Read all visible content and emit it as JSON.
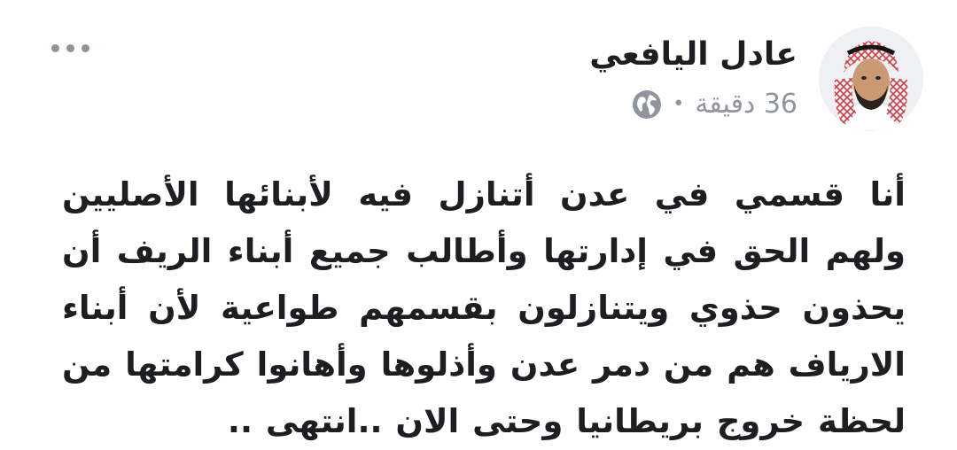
{
  "post": {
    "author": "عادل اليافعي",
    "time": "36 دقيقة",
    "separator": "•",
    "privacy_icon": "globe-icon",
    "more_icon": "more-options-icon",
    "text": "أنا قسمي في عدن أتنازل فيه لأبنائها الأصليين ولهم الحق في إدارتها وأطالب جميع أبناء الريف أن يحذون حذوي ويتنازلون بقسمهم طواعية لأن أبناء الارياف هم من دمر عدن وأذلوها وأهانوا كرامتها من لحظة خروج بريطانيا وحتى الان ..انتهى .."
  },
  "colors": {
    "text": "#1c1e21",
    "meta": "#90949c",
    "background": "#ffffff"
  }
}
